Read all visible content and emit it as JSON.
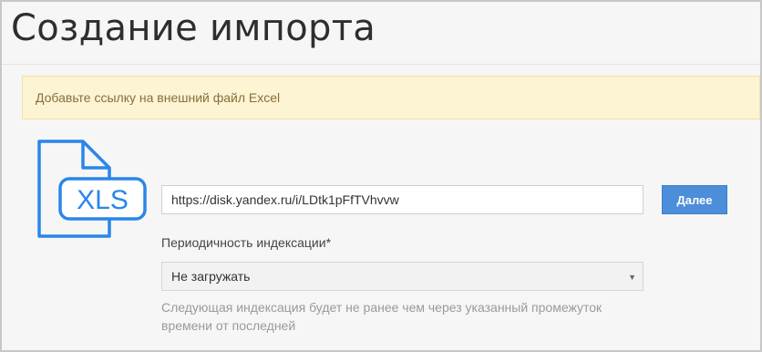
{
  "page": {
    "title": "Создание импорта"
  },
  "notice": {
    "text": "Добавьте ссылку на внешний файл Excel"
  },
  "file_icon": {
    "name": "xls-file-icon",
    "label": "XLS",
    "color": "#2a86e8"
  },
  "form": {
    "url_value": "https://disk.yandex.ru/i/LDtk1pFfTVhvvw",
    "next_button": "Далее",
    "period_label": "Периодичность индексации*",
    "period_selected": "Не загружать",
    "hint": "Следующая индексация будет не ранее чем через указанный промежуток времени от последней"
  },
  "colors": {
    "notice_bg": "#fcf4d2",
    "notice_text": "#8a6d3b",
    "accent": "#4c8ed9"
  }
}
